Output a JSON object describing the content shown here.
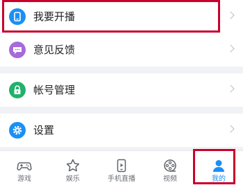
{
  "menu": {
    "items": [
      {
        "label": "我要开播",
        "icon": "phone-broadcast-icon",
        "color": "#1b90f4"
      },
      {
        "label": "意见反馈",
        "icon": "feedback-chat-icon",
        "color": "#a66ad9"
      },
      {
        "label": "帐号管理",
        "icon": "lock-icon",
        "color": "#20b26b"
      },
      {
        "label": "设置",
        "icon": "gear-icon",
        "color": "#1b90f4"
      }
    ]
  },
  "tabbar": {
    "tabs": [
      {
        "label": "游戏",
        "icon": "gamepad-icon"
      },
      {
        "label": "娱乐",
        "icon": "star-icon"
      },
      {
        "label": "手机直播",
        "icon": "mobile-live-icon"
      },
      {
        "label": "视频",
        "icon": "film-reel-icon"
      },
      {
        "label": "我的",
        "icon": "user-icon",
        "active": true
      }
    ]
  },
  "colors": {
    "accent": "#1b90f4",
    "highlight_box": "#c9002b"
  }
}
